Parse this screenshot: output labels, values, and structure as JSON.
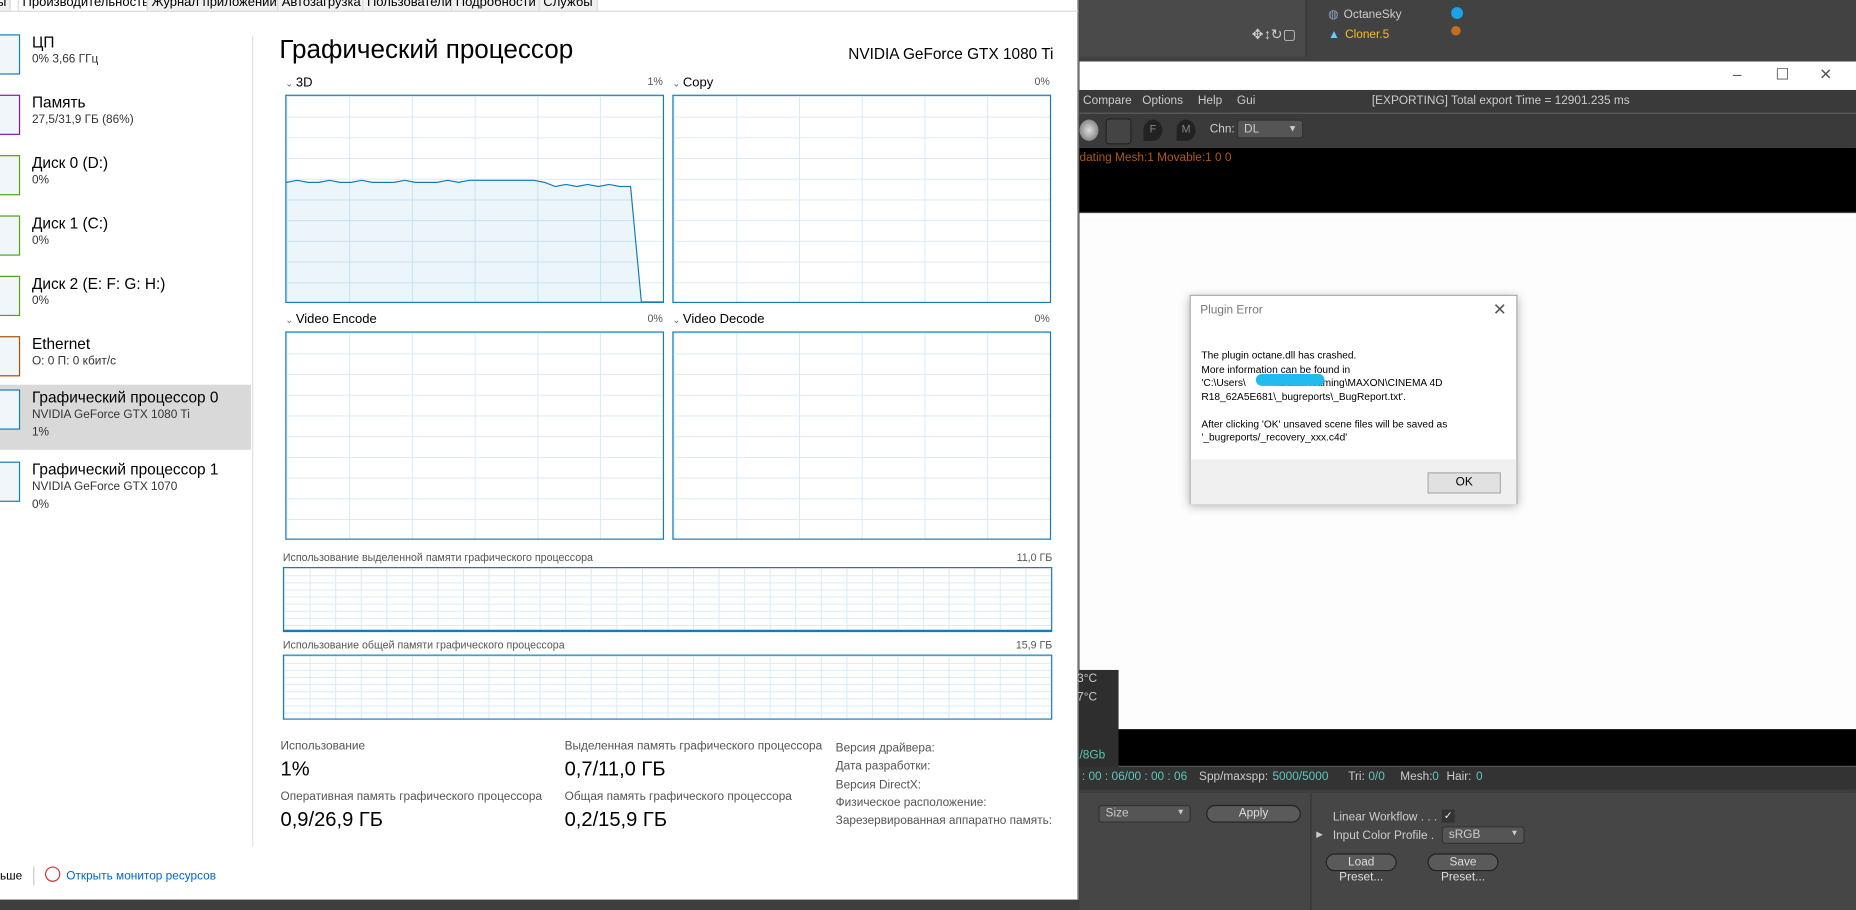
{
  "task_manager": {
    "tabs": [
      "сы",
      "Производительность",
      "Журнал приложений",
      "Автозагрузка",
      "Пользователи",
      "Подробности",
      "Службы"
    ],
    "sidebar": [
      {
        "title": "ЦП",
        "sub": "0%  3,66 ГГц",
        "color": "#117dbb"
      },
      {
        "title": "Память",
        "sub": "27,5/31,9 ГБ (86%)",
        "color": "#8b12ae"
      },
      {
        "title": "Диск 0 (D:)",
        "sub": "0%",
        "color": "#4da60c"
      },
      {
        "title": "Диск 1 (C:)",
        "sub": "0%",
        "color": "#4da60c"
      },
      {
        "title": "Диск 2 (E: F: G: H:)",
        "sub": "0%",
        "color": "#4da60c"
      },
      {
        "title": "Ethernet",
        "sub": "О: 0 П: 0 кбит/с",
        "color": "#a74f01"
      },
      {
        "title": "Графический процессор 0",
        "sub": "NVIDIA GeForce GTX 1080 Ti",
        "sub2": "1%",
        "color": "#117dbb",
        "selected": true
      },
      {
        "title": "Графический процессор 1",
        "sub": "NVIDIA GeForce GTX 1070",
        "sub2": "0%",
        "color": "#117dbb"
      }
    ],
    "heading": "Графический процессор",
    "gpu_name": "NVIDIA GeForce GTX 1080 Ti",
    "engines": [
      {
        "label": "3D",
        "pct": "1%"
      },
      {
        "label": "Copy",
        "pct": "0%"
      },
      {
        "label": "Video Encode",
        "pct": "0%"
      },
      {
        "label": "Video Decode",
        "pct": "0%"
      }
    ],
    "history_3d_percent": [
      58,
      59,
      58,
      58,
      59,
      58,
      58,
      59,
      58,
      58,
      58,
      59,
      58,
      58,
      58,
      59,
      58,
      59,
      59,
      59,
      59,
      59,
      59,
      59,
      58,
      56,
      57,
      56,
      57,
      56,
      57,
      56,
      56,
      0,
      0,
      0
    ],
    "dedicated_mem_label": "Использование выделенной памяти графического процессора",
    "dedicated_mem_max": "11,0 ГБ",
    "shared_mem_label": "Использование общей памяти графического процессора",
    "shared_mem_max": "15,9 ГБ",
    "stats": {
      "usage_label": "Использование",
      "usage": "1%",
      "ded_label": "Выделенная память графического процессора",
      "ded": "0,7/11,0 ГБ",
      "ram_label": "Оперативная память графического процессора",
      "ram": "0,9/26,9 ГБ",
      "shared_label": "Общая память графического процессора",
      "shared": "0,2/15,9 ГБ",
      "info": [
        "Версия драйвера:",
        "Дата разработки:",
        "Версия DirectX:",
        "Физическое расположение:",
        "Зарезервированная аппаратно память:"
      ]
    },
    "footer": {
      "less": "ьше",
      "monitor": "Открыть монитор ресурсов"
    }
  },
  "c4d": {
    "objects": [
      {
        "name": "OctaneSky",
        "color": "#cccccc"
      },
      {
        "name": "Cloner.5",
        "color": "#f0c020"
      }
    ],
    "menu": [
      "Compare",
      "Options",
      "Help",
      "Gui"
    ],
    "export_status": "[EXPORTING] Total export Time = 12901.235 ms",
    "chn_label": "Chn:",
    "chn_value": "DL",
    "log_line": "dating Mesh:1 Movable:1  0 0",
    "side_vals": [
      "3°C",
      "7°C",
      "/8Gb"
    ],
    "status": {
      "time": ": 00 : 06/00 : 00 : 06",
      "spp_label": "Spp/maxspp:",
      "spp": "5000/5000",
      "tri_label": "Tri:",
      "tri": "0/0",
      "mesh_label": "Mesh:",
      "mesh": "0",
      "hair_label": "Hair:",
      "hair": "0"
    },
    "size_select": "Size",
    "apply": "Apply",
    "linear_workflow": "Linear Workflow . . .",
    "input_profile_label": "Input Color Profile .",
    "input_profile": "sRGB",
    "load_preset": "Load Preset...",
    "save_preset": "Save Preset..."
  },
  "dialog": {
    "title": "Plugin Error",
    "message": "The plugin octane.dll has crashed.\nMore information can be found in\n'C:\\Users\\          nData\\Roaming\\MAXON\\CINEMA 4D\nR18_62A5E681\\_bugreports\\_BugReport.txt'.\n\nAfter clicking 'OK' unsaved scene files will be saved as\n'_bugreports/_recovery_xxx.c4d'",
    "ok": "OK"
  }
}
